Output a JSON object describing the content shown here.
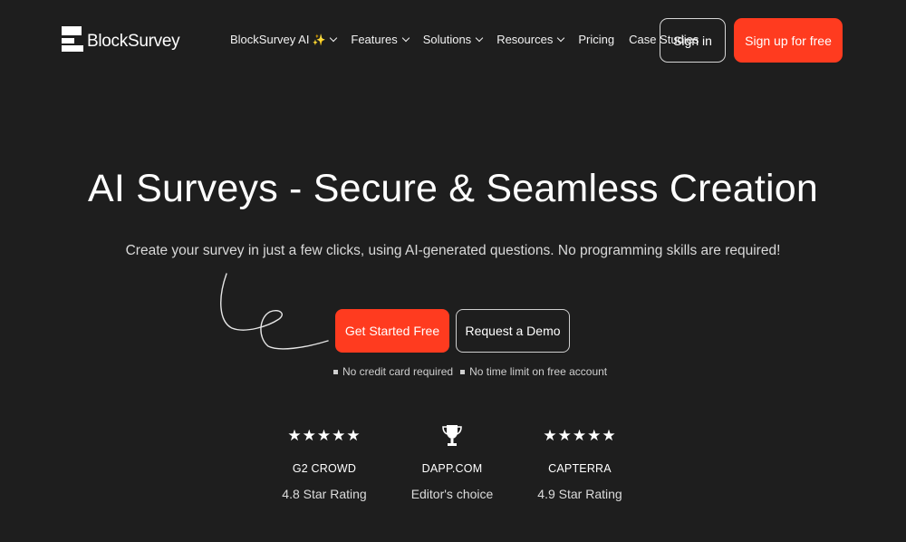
{
  "header": {
    "logo_text": "BlockSurvey",
    "nav": [
      {
        "label": "BlockSurvey AI",
        "sparkle": "✨",
        "has_dropdown": true
      },
      {
        "label": "Features",
        "has_dropdown": true
      },
      {
        "label": "Solutions",
        "has_dropdown": true
      },
      {
        "label": "Resources",
        "has_dropdown": true
      },
      {
        "label": "Pricing",
        "has_dropdown": false
      },
      {
        "label": "Case Studies",
        "has_dropdown": false
      }
    ],
    "signin_label": "Sign in",
    "signup_label": "Sign up for free"
  },
  "hero": {
    "title": "AI Surveys - Secure & Seamless Creation",
    "subtitle": "Create your survey in just a few clicks, using AI-generated questions. No programming skills are required!",
    "primary_cta": "Get Started Free",
    "secondary_cta": "Request a Demo",
    "notes": [
      "No credit card required",
      "No time limit on free account"
    ]
  },
  "ratings": [
    {
      "icon": "stars-icon",
      "stars": "★★★★★",
      "name": "G2 CROWD",
      "desc": "4.8 Star Rating"
    },
    {
      "icon": "trophy-icon",
      "name": "DAPP.COM",
      "desc": "Editor's choice"
    },
    {
      "icon": "stars-icon",
      "stars": "★★★★★",
      "name": "CAPTERRA",
      "desc": "4.9 Star Rating"
    }
  ],
  "colors": {
    "background": "#1e1e1e",
    "accent": "#ff3b1f",
    "text": "#ffffff"
  }
}
